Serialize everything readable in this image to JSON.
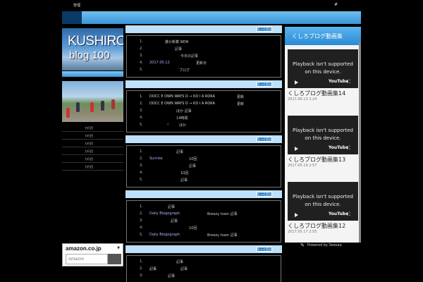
{
  "topbar": {
    "link": "管理",
    "right_icon": "#"
  },
  "logo": {
    "line1": "KUSHIRO",
    "line2": "blog 100"
  },
  "left_menu": [
    "カ行目",
    "カ行目",
    "カ行目",
    "カ行目",
    "カ行目",
    "カ行目"
  ],
  "amazon": {
    "logo": "amazon.co.jp",
    "placeholder": "Amazon"
  },
  "sections": [
    {
      "button": "もっと見る",
      "rows": [
        {
          "n": "1.",
          "t": "",
          "d": "誰か新着 NEW"
        },
        {
          "n": "2.",
          "t": "",
          "d": "記事"
        },
        {
          "n": "3.",
          "t": "",
          "d": "今日の記事"
        },
        {
          "n": "4.",
          "t": "2017.05.12",
          "d": "更新日"
        },
        {
          "n": "5.",
          "t": "",
          "d": "ブログ"
        }
      ]
    },
    {
      "button": "もっと見る",
      "rows": [
        {
          "n": "1.",
          "t": "DOCC E OWN WAYS D → KD I A ROKA",
          "d": "更新"
        },
        {
          "n": "2.",
          "t": "DOCC E OWN WAYS D → KD I A ROKA",
          "d": "更新"
        },
        {
          "n": "3.",
          "t": "",
          "d": "ほか 記事"
        },
        {
          "n": "4.",
          "t": "",
          "d": "14時間"
        },
        {
          "n": "5.",
          "t": "☆",
          "d": "ほか"
        }
      ]
    },
    {
      "button": "もっと見る",
      "rows": [
        {
          "n": "1.",
          "t": "",
          "d": "記事"
        },
        {
          "n": "2.",
          "t": "Sunrise",
          "d": "10回"
        },
        {
          "n": "3.",
          "t": "",
          "d": "記事"
        },
        {
          "n": "4.",
          "t": "",
          "d": "10回"
        },
        {
          "n": "5.",
          "t": "",
          "d": "記事"
        }
      ]
    },
    {
      "button": "もっと見る",
      "rows": [
        {
          "n": "1.",
          "t": "",
          "d": "記事"
        },
        {
          "n": "2.",
          "t": "Daily Blogograph",
          "d": "Breezy town 記事"
        },
        {
          "n": "3.",
          "t": "",
          "d": "記事"
        },
        {
          "n": "4.",
          "t": "",
          "d": "10回"
        },
        {
          "n": "5.",
          "t": "Daily Blogograph",
          "d": "Breezy town 記事"
        }
      ]
    },
    {
      "button": "もっと見る",
      "rows": [
        {
          "n": "1.",
          "t": "",
          "d": "記事"
        },
        {
          "n": "2.",
          "t": "記事",
          "d": "記事"
        },
        {
          "n": "3.",
          "t": "",
          "d": "記事"
        }
      ]
    }
  ],
  "right": {
    "title": "くしろブログ動画集",
    "videos": [
      {
        "msg1": "Playback isn't supported",
        "msg2": "on this device.",
        "yt": "YouTube",
        "title": "くしろブログ動画集14",
        "date": "2017.06.13 2:24"
      },
      {
        "msg1": "Playback isn't supported",
        "msg2": "on this device.",
        "yt": "YouTube",
        "title": "くしろブログ動画集13",
        "date": "2017.05.19 2:57"
      },
      {
        "msg1": "Playback isn't supported",
        "msg2": "on this device.",
        "yt": "YouTube",
        "title": "くしろブログ動画集12",
        "date": "2017.05.17 2:55"
      }
    ]
  },
  "powered": "Powered by Seesaa"
}
